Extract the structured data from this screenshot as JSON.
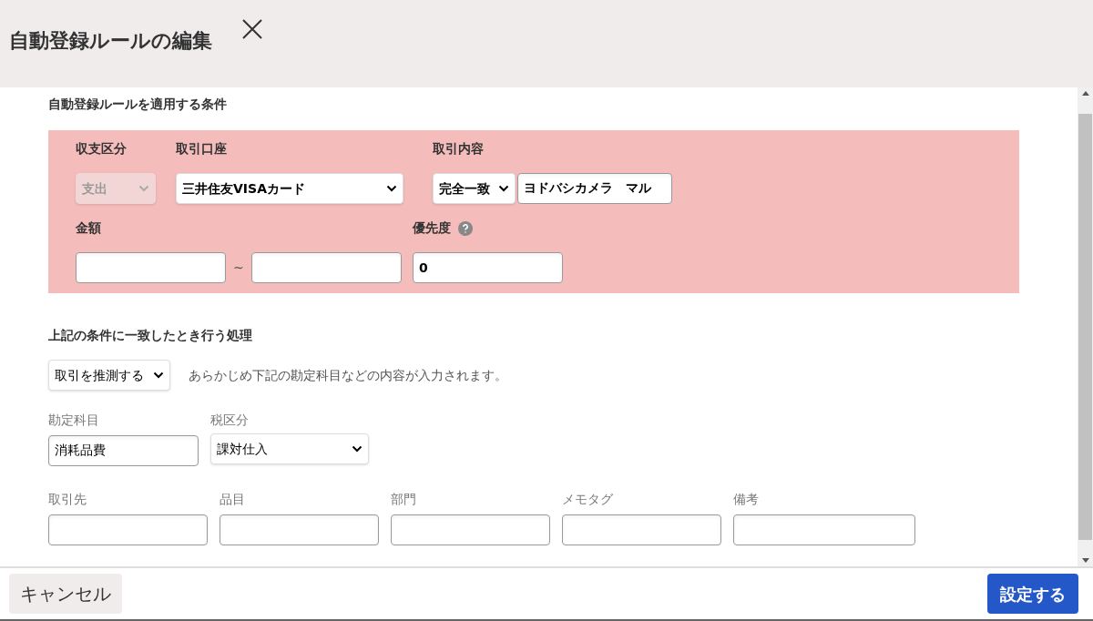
{
  "dialog": {
    "title": "自動登録ルールの編集"
  },
  "conditions": {
    "heading": "自動登録ルールを適用する条件",
    "income_type": {
      "label": "収支区分",
      "value": "支出",
      "disabled": true
    },
    "account": {
      "label": "取引口座",
      "value": "三井住友VISAカード"
    },
    "content": {
      "label": "取引内容",
      "match": "完全一致",
      "value": "ヨドバシカメラ　マル"
    },
    "amount": {
      "label": "金額",
      "separator": "~"
    },
    "priority": {
      "label": "優先度",
      "value": "0"
    }
  },
  "action": {
    "heading": "上記の条件に一致したとき行う処理",
    "mode": "取引を推測する",
    "note": "あらかじめ下記の勘定科目などの内容が入力されます。",
    "account_item": {
      "label": "勘定科目",
      "value": "消耗品費"
    },
    "tax": {
      "label": "税区分",
      "value": "課対仕入"
    },
    "fields": [
      {
        "label": "取引先"
      },
      {
        "label": "品目"
      },
      {
        "label": "部門"
      },
      {
        "label": "メモタグ"
      },
      {
        "label": "備考"
      }
    ]
  },
  "footer": {
    "cancel": "キャンセル",
    "submit": "設定する"
  }
}
